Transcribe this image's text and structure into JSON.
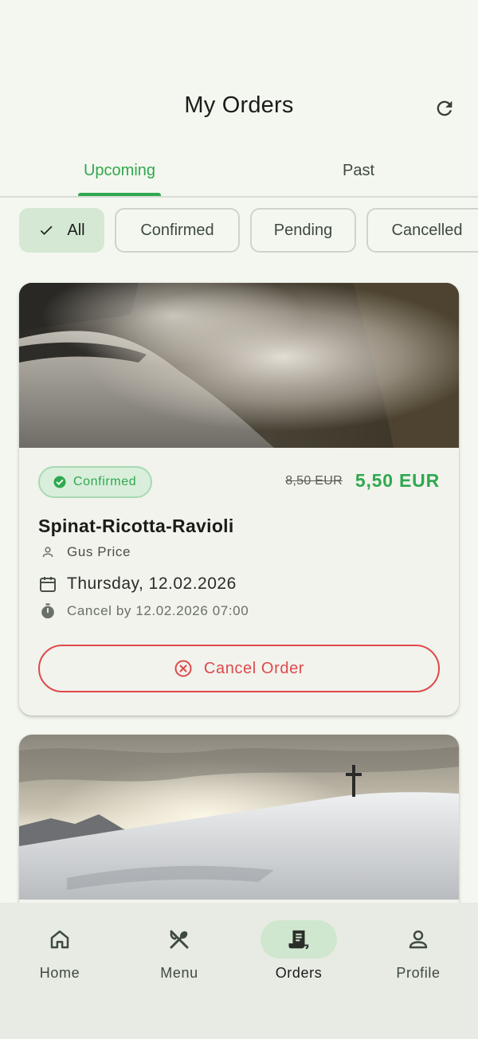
{
  "header": {
    "title": "My Orders",
    "refresh_icon": "refresh-icon"
  },
  "tabs": [
    {
      "label": "Upcoming",
      "active": true
    },
    {
      "label": "Past",
      "active": false
    }
  ],
  "filters": [
    {
      "label": "All",
      "selected": true
    },
    {
      "label": "Confirmed",
      "selected": false
    },
    {
      "label": "Pending",
      "selected": false
    },
    {
      "label": "Cancelled",
      "selected": false
    }
  ],
  "orders": [
    {
      "status": "Confirmed",
      "original_price": "8,50 EUR",
      "price": "5,50 EUR",
      "dish": "Spinat-Ricotta-Ravioli",
      "cook": "Gus Price",
      "date": "Thursday, 12.02.2026",
      "cancel_deadline": "Cancel by 12.02.2026 07:00",
      "cancel_label": "Cancel Order",
      "image": "waterfall-mist-photo"
    },
    {
      "image": "snowy-summit-cross-photo"
    }
  ],
  "bottom_nav": [
    {
      "label": "Home",
      "icon": "home-icon",
      "active": false
    },
    {
      "label": "Menu",
      "icon": "fork-spoon-icon",
      "active": false
    },
    {
      "label": "Orders",
      "icon": "receipt-icon",
      "active": true
    },
    {
      "label": "Profile",
      "icon": "person-icon",
      "active": false
    }
  ],
  "colors": {
    "accent": "#2fa84f",
    "danger": "#e0484c",
    "background": "#f4f7ef",
    "selected_chip": "#d4e8d4"
  }
}
